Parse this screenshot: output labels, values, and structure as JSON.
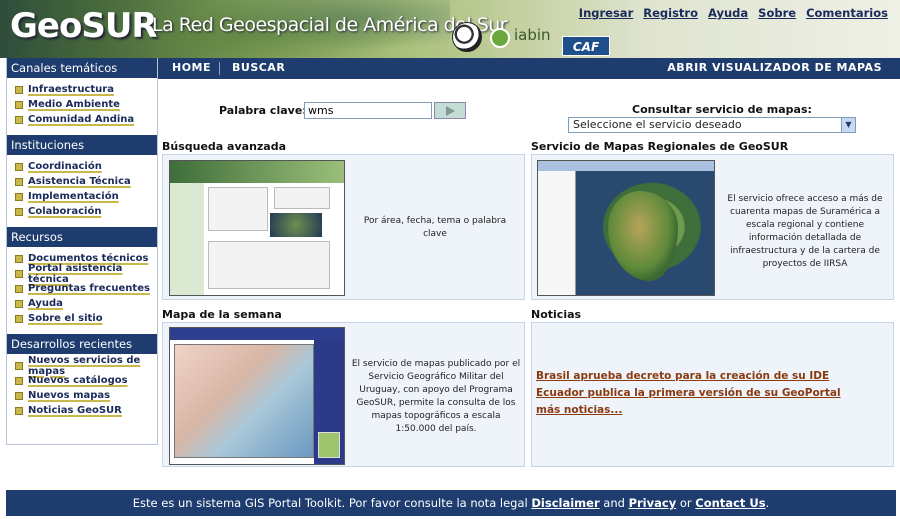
{
  "header": {
    "logo": "GeoSUR",
    "tagline": "La Red Geoespacial de América del Sur",
    "partner_iabin": "iabin",
    "partner_caf": "CAF",
    "links": [
      "Ingresar",
      "Registro",
      "Ayuda",
      "Sobre",
      "Comentarios"
    ]
  },
  "nav": {
    "home": "HOME",
    "buscar": "BUSCAR",
    "viewer": "ABRIR VISUALIZADOR DE MAPAS"
  },
  "sidebar": {
    "sections": [
      {
        "title": "Canales temáticos",
        "items": [
          "Infraestructura",
          "Medio Ambiente",
          "Comunidad Andina"
        ]
      },
      {
        "title": "Instituciones participantes",
        "items": [
          "Coordinación",
          "Asistencia Técnica",
          "Implementación",
          "Colaboración"
        ]
      },
      {
        "title": "Recursos",
        "items": [
          "Documentos técnicos",
          "Portal asistencia técnica",
          "Preguntas frecuentes",
          "Ayuda",
          "Sobre el sitio"
        ]
      },
      {
        "title": "Desarrollos recientes",
        "items": [
          "Nuevos servicios de mapas",
          "Nuevos catálogos",
          "Nuevos mapas",
          "Noticias GeoSUR"
        ]
      }
    ]
  },
  "search": {
    "label": "Palabra clave:",
    "value": "wms",
    "service_label": "Consultar servicio de mapas:",
    "service_selected": "Seleccione el servicio deseado"
  },
  "panels": {
    "advanced": {
      "title": "Búsqueda avanzada",
      "text": "Por área, fecha, tema o palabra clave"
    },
    "regional": {
      "title": "Servicio de Mapas Regionales de GeoSUR",
      "text": "El servicio ofrece acceso a más de cuarenta mapas de Suramérica a escala regional y contiene información detallada de infraestructura y de la cartera de proyectos de IIRSA"
    },
    "week": {
      "title": "Mapa de la semana",
      "text": "El servicio de mapas publicado por el Servicio Geográfico Militar del Uruguay, con apoyo del Programa GeoSUR, permite la consulta de los mapas topográficos a escala 1:50.000 del país."
    },
    "news": {
      "title": "Noticias",
      "items": [
        "Brasil aprueba decreto para la creación de su IDE",
        "Ecuador publica la primera versión de su GeoPortal",
        "más noticias..."
      ]
    }
  },
  "footer": {
    "text": "Este es un sistema GIS Portal Toolkit. Por favor consulte la nota legal",
    "disclaimer": "Disclaimer",
    "and": "and",
    "privacy": "Privacy",
    "or": "or",
    "contact": "Contact Us",
    "end": "."
  },
  "colors": {
    "nav": "#1e3c6e",
    "news_link": "#8a3a10",
    "panel_bg": "#eef4fa"
  }
}
